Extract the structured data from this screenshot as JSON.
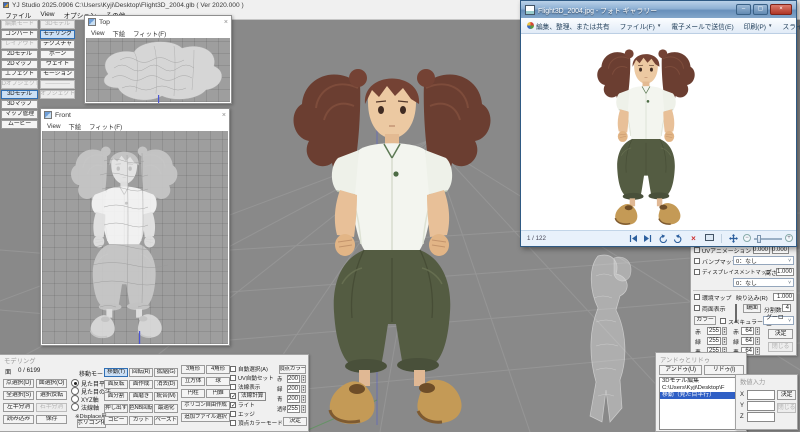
{
  "app": {
    "title": "YJ Studio 2025.0906   C:\\Users\\Kyji\\Desktop\\Flight3D_2004.glb ( Ver 2020.000 )",
    "menu": [
      "ファイル",
      "View",
      "オプション",
      "その他"
    ]
  },
  "sidebar": {
    "col1_header": "編集モード",
    "col1": [
      {
        "label": "コンバート"
      },
      {
        "label": "レイアウト",
        "state": "disabled"
      },
      {
        "label": "2Dモデル"
      },
      {
        "label": "2Dマップ"
      },
      {
        "label": "エフェクト"
      },
      {
        "label": "3Dオブジェクト",
        "state": "disabled"
      },
      {
        "label": "3Dモデル",
        "state": "selected"
      },
      {
        "label": "3Dマップ"
      },
      {
        "label": "マップ管理"
      },
      {
        "label": "ムービー"
      }
    ],
    "col2_header": "3Dモデル",
    "col2": [
      {
        "label": "モデリング",
        "state": "selected"
      },
      {
        "label": "テクスチャ"
      },
      {
        "label": "ボーン"
      },
      {
        "label": "ウェイト"
      },
      {
        "label": "モーション"
      },
      {
        "label": "──────",
        "state": "disabled"
      },
      {
        "label": "オブジェクト",
        "state": "disabled"
      }
    ]
  },
  "top_window": {
    "title": "Top",
    "menu": [
      "View",
      "下絵",
      "フィット(F)"
    ],
    "close": "×"
  },
  "front_window": {
    "title": "Front",
    "menu": [
      "View",
      "下絵",
      "フィット(F)"
    ],
    "close": "×"
  },
  "photo_viewer": {
    "title": "Flight3D_2004.jpg - フォト ギャラリー",
    "window_buttons": {
      "minimize": "–",
      "maximize": "▢",
      "close": "×"
    },
    "toolbar": {
      "organize": "編集、整理、または共有",
      "file": "ファイル(F)",
      "email": "電子メールで送信(E)",
      "print": "印刷(P)",
      "slideshow": "スライド ショー(S)",
      "help": "?"
    },
    "counter": "1 / 122"
  },
  "material_panel": {
    "uv_anim": {
      "label": "UVアニメーション",
      "v1": "0.000",
      "v2": "0.000"
    },
    "bump": {
      "label": "バンプマップ",
      "value": "0：なし"
    },
    "displacement": {
      "label": "ディスプレイスメントマップ",
      "height_label": "高さ",
      "height": "1.000",
      "value": "0：なし"
    },
    "env": {
      "label": "環境マップ",
      "reflect_label": "映り込み(R)",
      "reflect": "1.000"
    },
    "two_sided": "両面表示",
    "mirror": "鏡面",
    "divisions_label": "分割数",
    "divisions": "4",
    "color_button": "カラー",
    "specular": "スペキュラー",
    "shading": "グーロー",
    "colors_left": [
      {
        "label": "赤",
        "value": "255"
      },
      {
        "label": "緑",
        "value": "255"
      },
      {
        "label": "青",
        "value": "255"
      },
      {
        "label": "透明",
        "value": "255"
      }
    ],
    "colors_right": [
      {
        "label": "赤",
        "value": "64"
      },
      {
        "label": "緑",
        "value": "64"
      },
      {
        "label": "青",
        "value": "64"
      }
    ],
    "ok": "決定",
    "close": "閉じる"
  },
  "undo_panel": {
    "title": "アンドゥとリドゥ",
    "undo": "アンドゥ(U)",
    "redo": "リドゥ(I)",
    "items": [
      {
        "label": "3Dモデル編集"
      },
      {
        "label": "C:\\Users\\Kyji\\Desktop\\F"
      },
      {
        "label": "移動（見た目平行）",
        "state": "selected"
      }
    ]
  },
  "numeric_panel": {
    "title": "数値入力",
    "axes": [
      "X",
      "Y",
      "Z"
    ],
    "ok": "決定",
    "close": "閉じる"
  },
  "modeling_panel": {
    "title": "モデリング",
    "face_label": "面",
    "face_count": "0 / 6199",
    "sel_buttons": [
      {
        "label": "点選択(D)"
      },
      {
        "label": "面選択(O)"
      },
      {
        "label": "全選択(S)"
      },
      {
        "label": "選択反転"
      },
      {
        "label": "左半分消"
      },
      {
        "label": "右半分消",
        "state": "disabled"
      },
      {
        "label": "読み込み"
      },
      {
        "label": "保存"
      }
    ],
    "move_mode_label": "移動モード",
    "move_modes": [
      {
        "label": "見た目平行",
        "state": "checked"
      },
      {
        "label": "見た目の法"
      },
      {
        "label": "XYZ軸"
      },
      {
        "label": "法線軸"
      }
    ],
    "displace_note": "※Displace用",
    "polygonize": "ポリゴン化",
    "edit_buttons": [
      {
        "label": "移動(T)",
        "state": "selected"
      },
      {
        "label": "回転(R)"
      },
      {
        "label": "拡縮(G)"
      },
      {
        "label": "面反転"
      },
      {
        "label": "面作成"
      },
      {
        "label": "消去(D)"
      },
      {
        "label": "面分割"
      },
      {
        "label": "面磨き"
      },
      {
        "label": "統合(M)"
      },
      {
        "label": "押し出す"
      },
      {
        "label": "色NB回転"
      },
      {
        "label": "最適化"
      },
      {
        "label": "コピー"
      },
      {
        "label": "カット"
      },
      {
        "label": "ペースト"
      }
    ],
    "shape_buttons": [
      {
        "label": "3角形"
      },
      {
        "label": "4角形"
      },
      {
        "label": "立方体"
      },
      {
        "label": "球"
      },
      {
        "label": "円柱"
      },
      {
        "label": "円錐"
      }
    ],
    "poly_free": "ポリゴン自由作成",
    "add_file": "追加ファイル選択",
    "checks": [
      {
        "label": "自動選択(A)"
      },
      {
        "label": "UV自動セット"
      },
      {
        "label": "法線表示"
      },
      {
        "label": "法線計算",
        "state": "checked boxed"
      },
      {
        "label": "ライト",
        "state": "checked"
      },
      {
        "label": "エッジ"
      },
      {
        "label": "頂点カラーモード"
      }
    ],
    "vertex_color_button": "頂点カラー",
    "vc_values": [
      {
        "label": "赤",
        "value": "200"
      },
      {
        "label": "緑",
        "value": "200"
      },
      {
        "label": "青",
        "value": "200"
      },
      {
        "label": "透明",
        "value": "255"
      }
    ],
    "ok": "決定"
  },
  "colors": {
    "canvas_gray": "#898989",
    "viewport_gray": "#9e9e9e",
    "selection_blue": "#2f6fb5",
    "photo_title_blue": "#6890bb",
    "close_red": "#b03626",
    "undo_selected_blue": "#2f5fc5",
    "hair_brown": "#6b3e31",
    "shirt_white": "#f3f5ef",
    "pants_green": "#545c42",
    "shoe_tan": "#c49a56",
    "axis_blue": "#4b55d6"
  }
}
